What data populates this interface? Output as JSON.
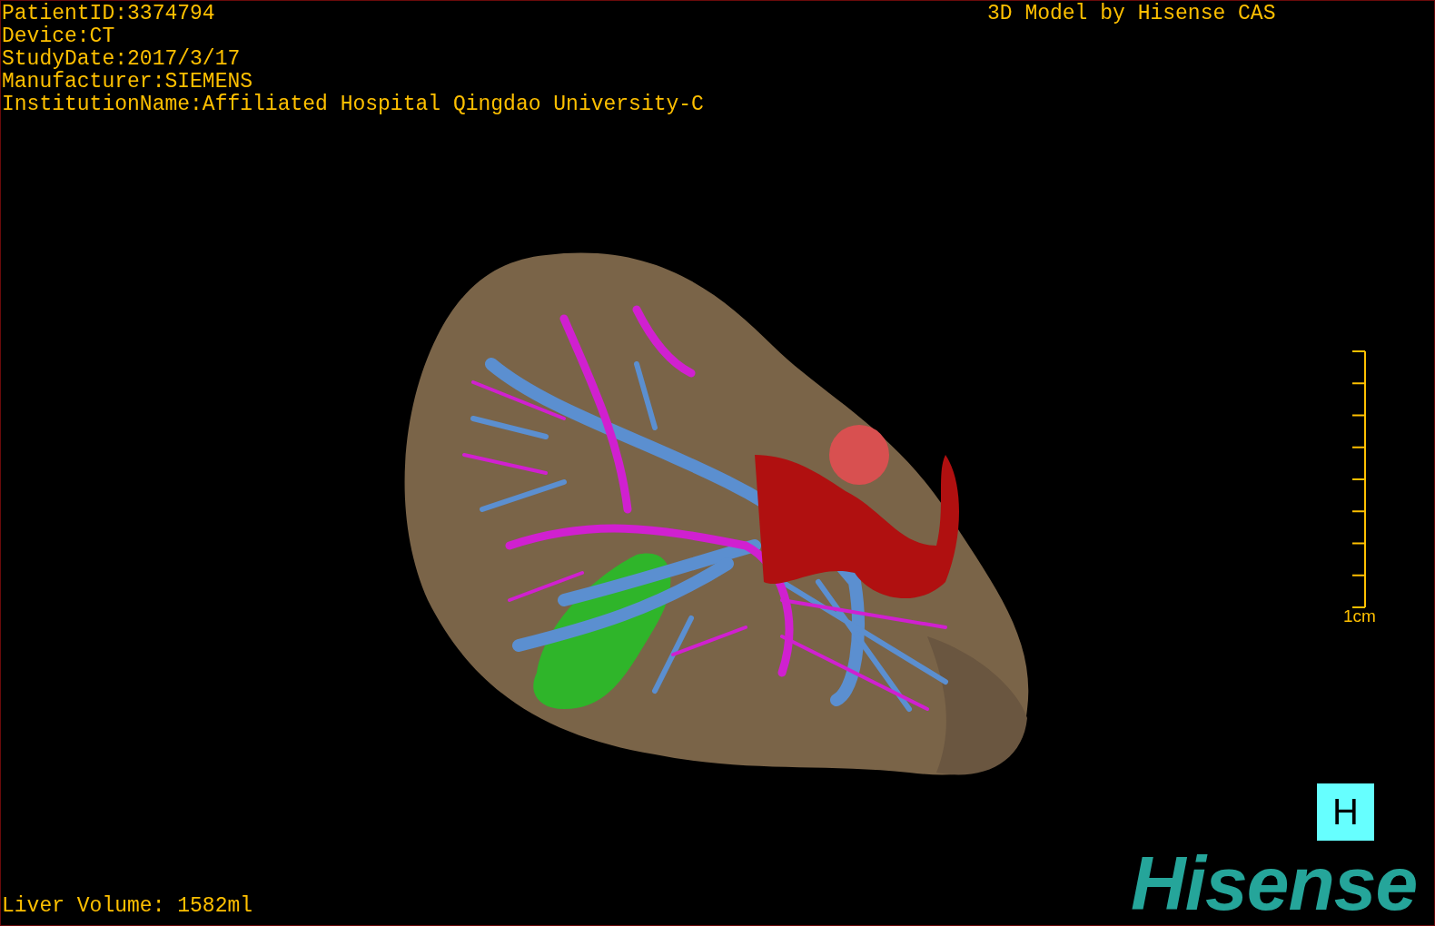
{
  "info_lines": [
    "PatientID:3374794",
    "Device:CT",
    "StudyDate:2017/3/17",
    "Manufacturer:SIEMENS",
    "InstitutionName:Affiliated Hospital Qingdao University-C"
  ],
  "header_right": "3D Model by Hisense CAS",
  "scale_bar": {
    "label": "1cm"
  },
  "orientation_marker": "H",
  "logo": "Hisense",
  "liver_volume": "Liver Volume: 1582ml"
}
